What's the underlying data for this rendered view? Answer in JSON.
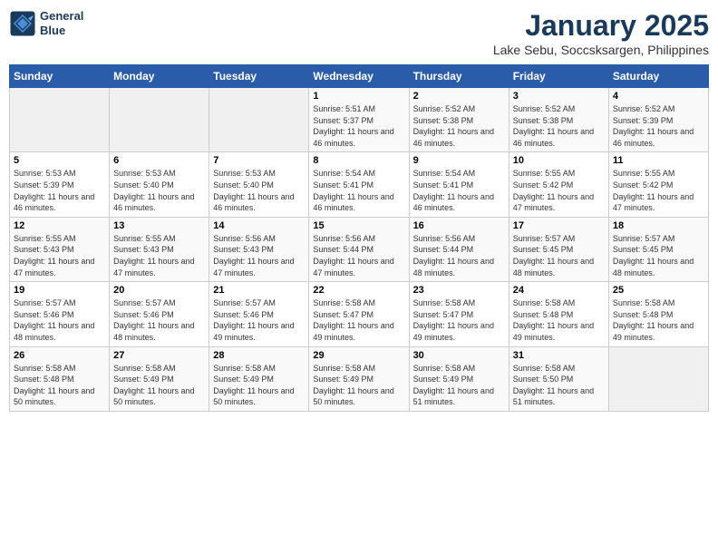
{
  "header": {
    "logo_line1": "General",
    "logo_line2": "Blue",
    "title": "January 2025",
    "subtitle": "Lake Sebu, Soccsksargen, Philippines"
  },
  "weekdays": [
    "Sunday",
    "Monday",
    "Tuesday",
    "Wednesday",
    "Thursday",
    "Friday",
    "Saturday"
  ],
  "weeks": [
    [
      {
        "day": "",
        "sunrise": "",
        "sunset": "",
        "daylight": "",
        "empty": true
      },
      {
        "day": "",
        "sunrise": "",
        "sunset": "",
        "daylight": "",
        "empty": true
      },
      {
        "day": "",
        "sunrise": "",
        "sunset": "",
        "daylight": "",
        "empty": true
      },
      {
        "day": "1",
        "sunrise": "Sunrise: 5:51 AM",
        "sunset": "Sunset: 5:37 PM",
        "daylight": "Daylight: 11 hours and 46 minutes."
      },
      {
        "day": "2",
        "sunrise": "Sunrise: 5:52 AM",
        "sunset": "Sunset: 5:38 PM",
        "daylight": "Daylight: 11 hours and 46 minutes."
      },
      {
        "day": "3",
        "sunrise": "Sunrise: 5:52 AM",
        "sunset": "Sunset: 5:38 PM",
        "daylight": "Daylight: 11 hours and 46 minutes."
      },
      {
        "day": "4",
        "sunrise": "Sunrise: 5:52 AM",
        "sunset": "Sunset: 5:39 PM",
        "daylight": "Daylight: 11 hours and 46 minutes."
      }
    ],
    [
      {
        "day": "5",
        "sunrise": "Sunrise: 5:53 AM",
        "sunset": "Sunset: 5:39 PM",
        "daylight": "Daylight: 11 hours and 46 minutes."
      },
      {
        "day": "6",
        "sunrise": "Sunrise: 5:53 AM",
        "sunset": "Sunset: 5:40 PM",
        "daylight": "Daylight: 11 hours and 46 minutes."
      },
      {
        "day": "7",
        "sunrise": "Sunrise: 5:53 AM",
        "sunset": "Sunset: 5:40 PM",
        "daylight": "Daylight: 11 hours and 46 minutes."
      },
      {
        "day": "8",
        "sunrise": "Sunrise: 5:54 AM",
        "sunset": "Sunset: 5:41 PM",
        "daylight": "Daylight: 11 hours and 46 minutes."
      },
      {
        "day": "9",
        "sunrise": "Sunrise: 5:54 AM",
        "sunset": "Sunset: 5:41 PM",
        "daylight": "Daylight: 11 hours and 46 minutes."
      },
      {
        "day": "10",
        "sunrise": "Sunrise: 5:55 AM",
        "sunset": "Sunset: 5:42 PM",
        "daylight": "Daylight: 11 hours and 47 minutes."
      },
      {
        "day": "11",
        "sunrise": "Sunrise: 5:55 AM",
        "sunset": "Sunset: 5:42 PM",
        "daylight": "Daylight: 11 hours and 47 minutes."
      }
    ],
    [
      {
        "day": "12",
        "sunrise": "Sunrise: 5:55 AM",
        "sunset": "Sunset: 5:43 PM",
        "daylight": "Daylight: 11 hours and 47 minutes."
      },
      {
        "day": "13",
        "sunrise": "Sunrise: 5:55 AM",
        "sunset": "Sunset: 5:43 PM",
        "daylight": "Daylight: 11 hours and 47 minutes."
      },
      {
        "day": "14",
        "sunrise": "Sunrise: 5:56 AM",
        "sunset": "Sunset: 5:43 PM",
        "daylight": "Daylight: 11 hours and 47 minutes."
      },
      {
        "day": "15",
        "sunrise": "Sunrise: 5:56 AM",
        "sunset": "Sunset: 5:44 PM",
        "daylight": "Daylight: 11 hours and 47 minutes."
      },
      {
        "day": "16",
        "sunrise": "Sunrise: 5:56 AM",
        "sunset": "Sunset: 5:44 PM",
        "daylight": "Daylight: 11 hours and 48 minutes."
      },
      {
        "day": "17",
        "sunrise": "Sunrise: 5:57 AM",
        "sunset": "Sunset: 5:45 PM",
        "daylight": "Daylight: 11 hours and 48 minutes."
      },
      {
        "day": "18",
        "sunrise": "Sunrise: 5:57 AM",
        "sunset": "Sunset: 5:45 PM",
        "daylight": "Daylight: 11 hours and 48 minutes."
      }
    ],
    [
      {
        "day": "19",
        "sunrise": "Sunrise: 5:57 AM",
        "sunset": "Sunset: 5:46 PM",
        "daylight": "Daylight: 11 hours and 48 minutes."
      },
      {
        "day": "20",
        "sunrise": "Sunrise: 5:57 AM",
        "sunset": "Sunset: 5:46 PM",
        "daylight": "Daylight: 11 hours and 48 minutes."
      },
      {
        "day": "21",
        "sunrise": "Sunrise: 5:57 AM",
        "sunset": "Sunset: 5:46 PM",
        "daylight": "Daylight: 11 hours and 49 minutes."
      },
      {
        "day": "22",
        "sunrise": "Sunrise: 5:58 AM",
        "sunset": "Sunset: 5:47 PM",
        "daylight": "Daylight: 11 hours and 49 minutes."
      },
      {
        "day": "23",
        "sunrise": "Sunrise: 5:58 AM",
        "sunset": "Sunset: 5:47 PM",
        "daylight": "Daylight: 11 hours and 49 minutes."
      },
      {
        "day": "24",
        "sunrise": "Sunrise: 5:58 AM",
        "sunset": "Sunset: 5:48 PM",
        "daylight": "Daylight: 11 hours and 49 minutes."
      },
      {
        "day": "25",
        "sunrise": "Sunrise: 5:58 AM",
        "sunset": "Sunset: 5:48 PM",
        "daylight": "Daylight: 11 hours and 49 minutes."
      }
    ],
    [
      {
        "day": "26",
        "sunrise": "Sunrise: 5:58 AM",
        "sunset": "Sunset: 5:48 PM",
        "daylight": "Daylight: 11 hours and 50 minutes."
      },
      {
        "day": "27",
        "sunrise": "Sunrise: 5:58 AM",
        "sunset": "Sunset: 5:49 PM",
        "daylight": "Daylight: 11 hours and 50 minutes."
      },
      {
        "day": "28",
        "sunrise": "Sunrise: 5:58 AM",
        "sunset": "Sunset: 5:49 PM",
        "daylight": "Daylight: 11 hours and 50 minutes."
      },
      {
        "day": "29",
        "sunrise": "Sunrise: 5:58 AM",
        "sunset": "Sunset: 5:49 PM",
        "daylight": "Daylight: 11 hours and 50 minutes."
      },
      {
        "day": "30",
        "sunrise": "Sunrise: 5:58 AM",
        "sunset": "Sunset: 5:49 PM",
        "daylight": "Daylight: 11 hours and 51 minutes."
      },
      {
        "day": "31",
        "sunrise": "Sunrise: 5:58 AM",
        "sunset": "Sunset: 5:50 PM",
        "daylight": "Daylight: 11 hours and 51 minutes."
      },
      {
        "day": "",
        "sunrise": "",
        "sunset": "",
        "daylight": "",
        "empty": true
      }
    ]
  ]
}
